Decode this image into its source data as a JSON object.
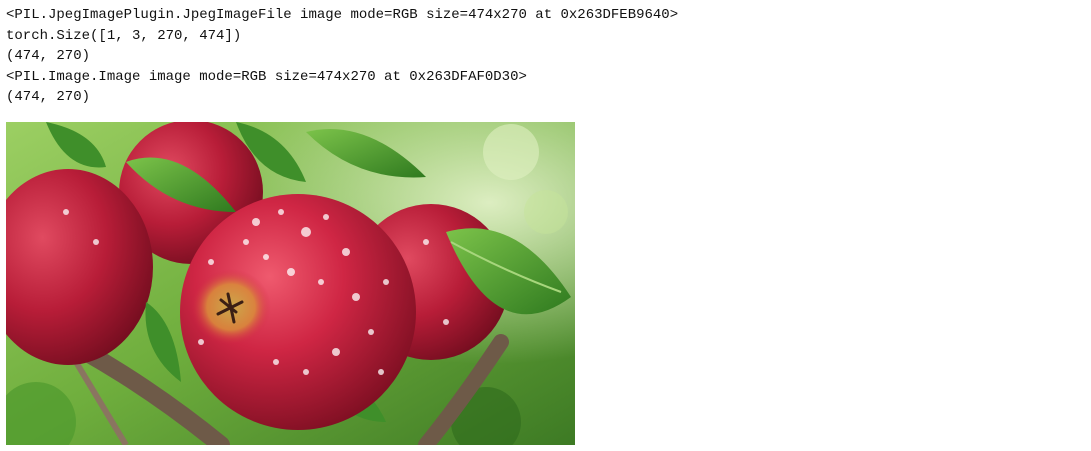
{
  "output": {
    "lines": [
      "<PIL.JpegImagePlugin.JpegImageFile image mode=RGB size=474x270 at 0x263DFEB9640>",
      "torch.Size([1, 3, 270, 474])",
      "(474, 270)",
      "<PIL.Image.Image image mode=RGB size=474x270 at 0x263DFAF0D30>",
      "(474, 270)"
    ]
  },
  "image": {
    "subject": "red-apples-with-water-droplets-photo",
    "colors": {
      "apple_red": "#c8233f",
      "apple_dark": "#8e1326",
      "leaf_green": "#3f8f2a",
      "background_green": "#7fbf4a",
      "branch": "#6e5a48"
    }
  }
}
